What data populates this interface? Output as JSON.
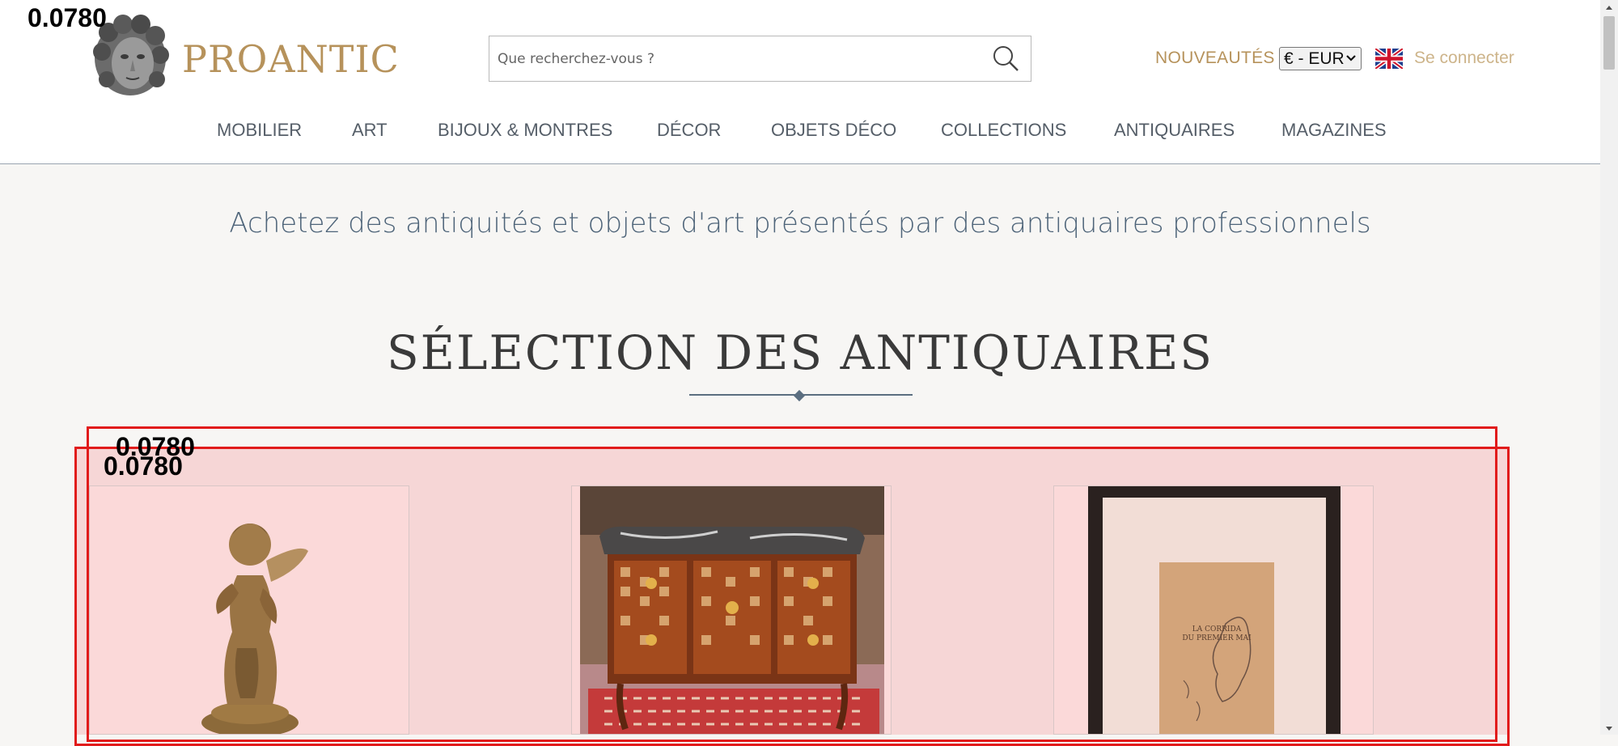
{
  "debug_labels": [
    "0.0780",
    "0.0780",
    "0.0780"
  ],
  "header": {
    "logo_text": "PROANTIC",
    "search_placeholder": "Que recherchez-vous ?",
    "nouveautes": "NOUVEAUTÉS",
    "currency": "€ - EUR",
    "login": "Se connecter",
    "icons": [
      "logo-head-icon",
      "search-icon",
      "uk-flag-icon",
      "chevron-down-icon"
    ]
  },
  "nav": [
    "MOBILIER",
    "ART",
    "BIJOUX & MONTRES",
    "DÉCOR",
    "OBJETS DÉCO",
    "COLLECTIONS",
    "ANTIQUAIRES",
    "MAGAZINES"
  ],
  "main": {
    "tagline": "Achetez des antiquités et objets d'art présentés par des antiquaires professionnels",
    "section_title": "SÉLECTION DES ANTIQUAIRES",
    "cards": [
      {
        "image": "bronze-cherub-statue"
      },
      {
        "image": "marble-top-marquetry-commode"
      },
      {
        "image": "framed-drawing-la-corrida"
      }
    ],
    "frame_text": [
      "LA CORRIDA",
      "DU PREMIER MAI"
    ]
  },
  "colors": {
    "brand_gold": "#b6925b",
    "nav_text": "#555e68",
    "tagline": "#4e6479",
    "overlay_red": "#e11b1b",
    "overlay_fill": "#f5cece"
  }
}
